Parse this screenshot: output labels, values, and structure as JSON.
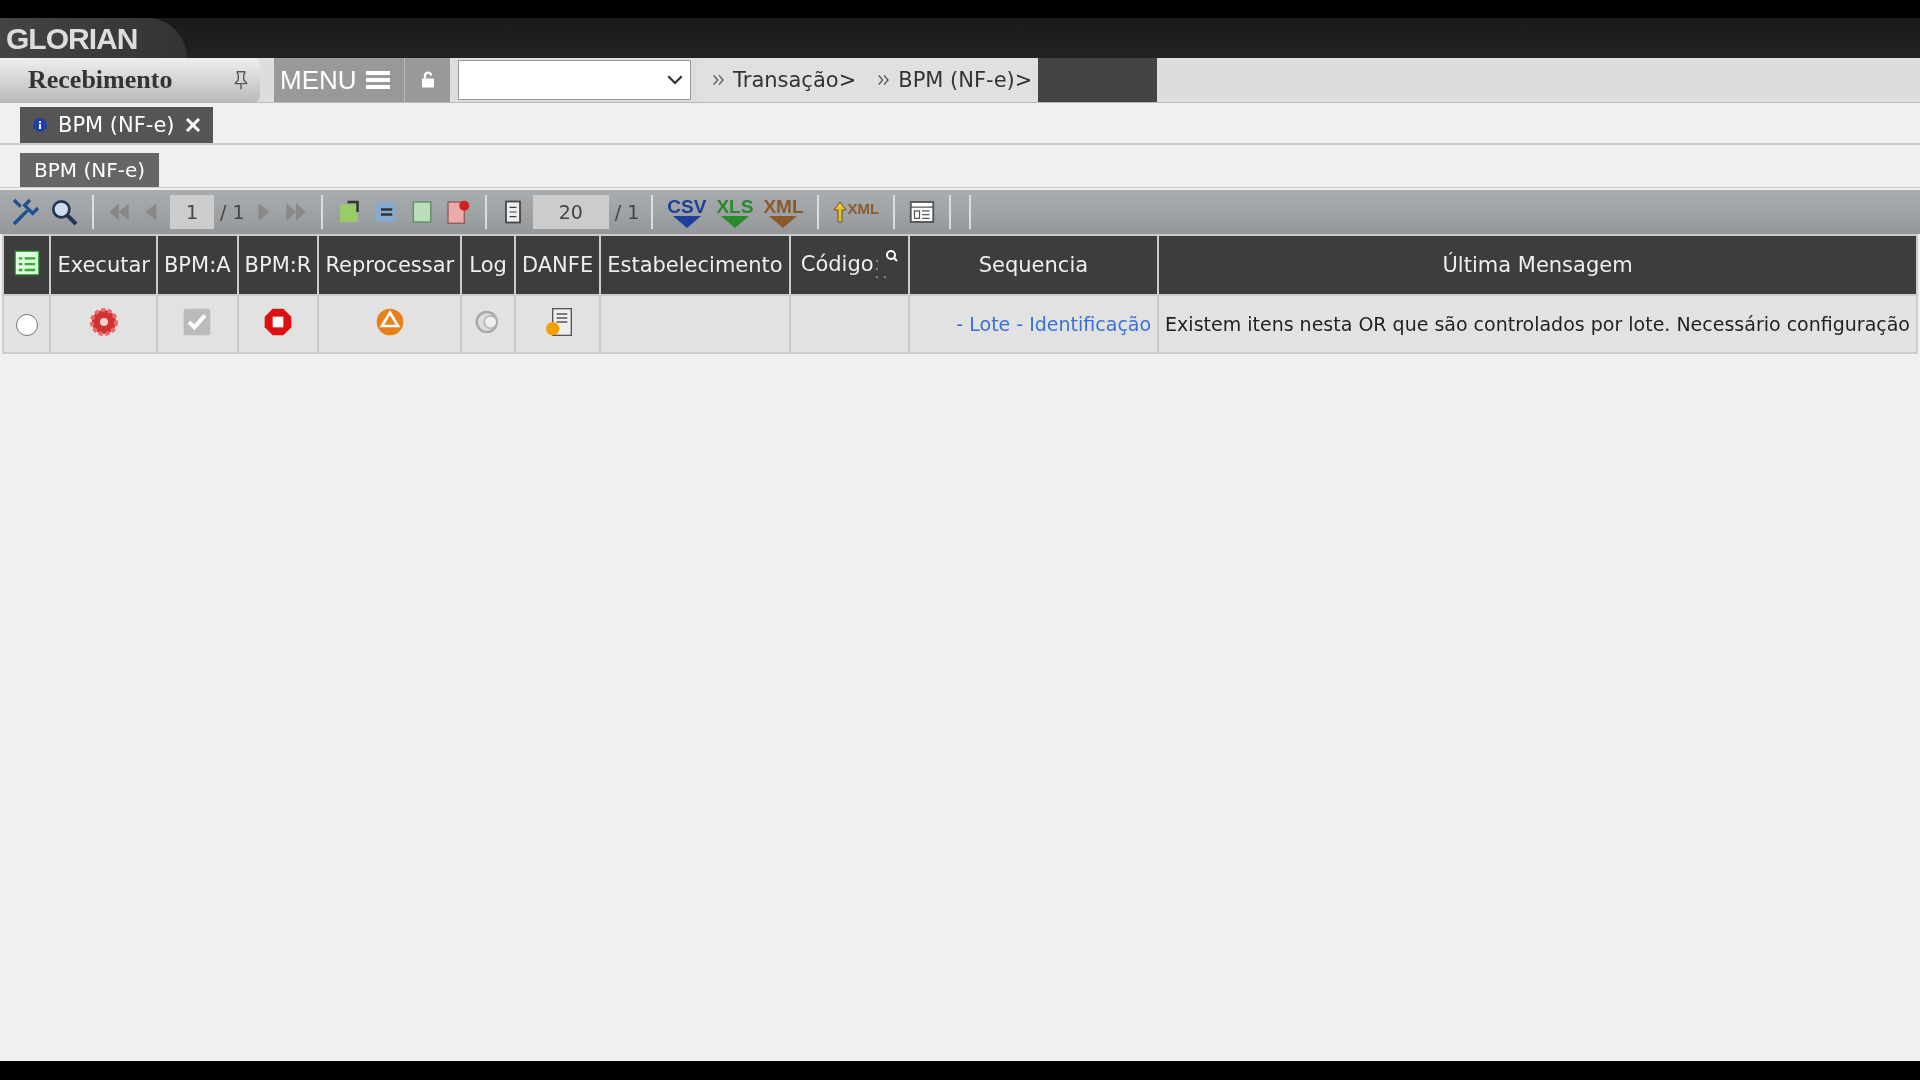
{
  "logo": "GLORIAN",
  "nav": {
    "module": "Recebimento",
    "menu": "MENU",
    "breadcrumbs": [
      "Transação>",
      "BPM (NF-e)>"
    ]
  },
  "tabs": [
    {
      "label": "BPM (NF-e)",
      "selected": true
    }
  ],
  "subtabs": [
    {
      "label": "BPM (NF-e)",
      "selected": true
    }
  ],
  "toolbar": {
    "page": "1",
    "page_total": "/ 1",
    "page_size": "20",
    "size_total": "/ 1",
    "exports": [
      {
        "label": "CSV",
        "color": "#1e3f99"
      },
      {
        "label": "XLS",
        "color": "#2a8a2a"
      },
      {
        "label": "XML",
        "color": "#8a5a2a"
      }
    ],
    "xml_upload": "XML"
  },
  "table": {
    "columns": [
      "Executar",
      "BPM:A",
      "BPM:R",
      "Reprocessar",
      "Log",
      "DANFE",
      "Estabelecimento",
      "Código",
      "Sequencia",
      "Última Mensagem"
    ],
    "rows": [
      {
        "selected": false,
        "sequencia": "- Lote - Identificação",
        "estabelecimento": "",
        "codigo": "",
        "mensagem": "Existem itens nesta OR que são controlados por lote. Necessário configuração"
      }
    ]
  }
}
